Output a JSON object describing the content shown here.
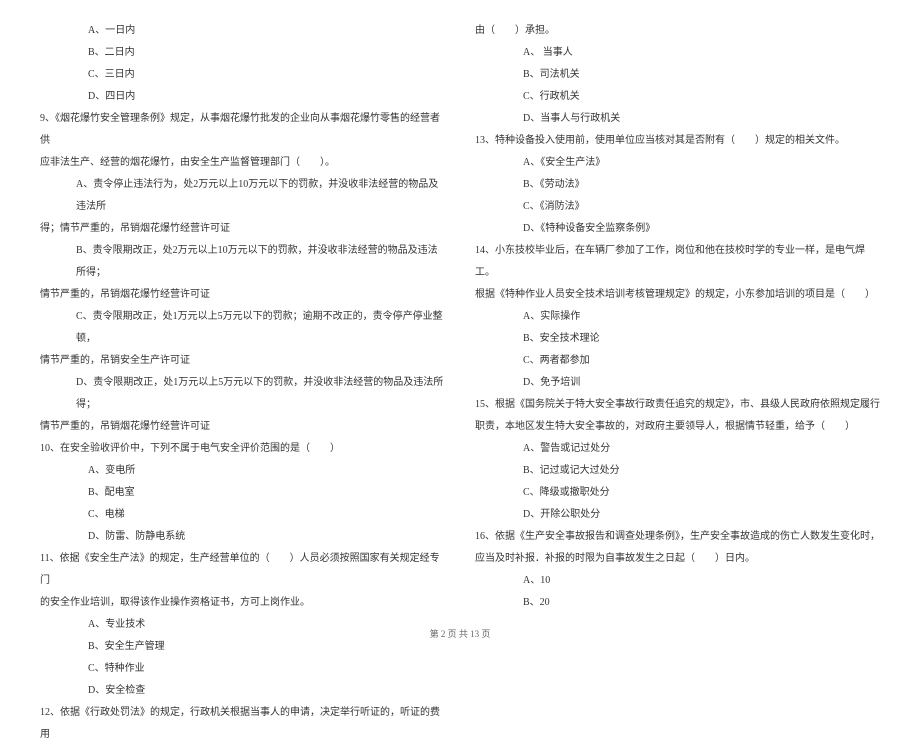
{
  "left_column": {
    "q8_options": [
      "A、一日内",
      "B、二日内",
      "C、三日内",
      "D、四日内"
    ],
    "q9_text": "9、《烟花爆竹安全管理条例》规定，从事烟花爆竹批发的企业向从事烟花爆竹零售的经营者供",
    "q9_continue": "应非法生产、经营的烟花爆竹，由安全生产监督管理部门（　　）。",
    "q9_options": [
      "A、责令停止违法行为，处2万元以上10万元以下的罚款，并没收非法经营的物品及违法所",
      "得；情节严重的，吊销烟花爆竹经营许可证",
      "B、责令限期改正，处2万元以上10万元以下的罚款，并没收非法经营的物品及违法所得；",
      "情节严重的，吊销烟花爆竹经营许可证",
      "C、责令限期改正，处1万元以上5万元以下的罚款；逾期不改正的，责令停产停业整顿，",
      "情节严重的，吊销安全生产许可证",
      "D、责令限期改正，处1万元以上5万元以下的罚款，并没收非法经营的物品及违法所得；",
      "情节严重的，吊销烟花爆竹经营许可证"
    ],
    "q10_text": "10、在安全验收评价中，下列不属于电气安全评价范围的是（　　）",
    "q10_options": [
      "A、变电所",
      "B、配电室",
      "C、电梯",
      "D、防雷、防静电系统"
    ],
    "q11_text": "11、依据《安全生产法》的规定，生产经营单位的（　　）人员必须按照国家有关规定经专门",
    "q11_continue": "的安全作业培训，取得该作业操作资格证书，方可上岗作业。",
    "q11_options": [
      "A、专业技术",
      "B、安全生产管理",
      "C、特种作业",
      "D、安全检查"
    ],
    "q12_text": "12、依据《行政处罚法》的规定，行政机关根据当事人的申请，决定举行听证的，听证的费用"
  },
  "right_column": {
    "q12_continue": "由（　　）承担。",
    "q12_options": [
      "A、 当事人",
      "B、司法机关",
      "C、行政机关",
      "D、当事人与行政机关"
    ],
    "q13_text": "13、特种设备投入使用前，使用单位应当核对其是否附有（　　）规定的相关文件。",
    "q13_options": [
      "A、《安全生产法》",
      "B、《劳动法》",
      "C、《消防法》",
      "D、《特种设备安全监察条例》"
    ],
    "q14_text": "14、小东技校毕业后，在车辆厂参加了工作，岗位和他在技校时学的专业一样，是电气焊工。",
    "q14_continue": "根据《特种作业人员安全技术培训考核管理规定》的规定，小东参加培训的项目是（　　）",
    "q14_options": [
      "A、实际操作",
      "B、安全技术理论",
      "C、两者都参加",
      "D、免予培训"
    ],
    "q15_text": "15、根据《国务院关于特大安全事故行政责任追究的规定》，市、县级人民政府依照规定履行",
    "q15_continue": "职责，本地区发生特大安全事故的，对政府主要领导人，根据情节轻重，给予（　　）",
    "q15_options": [
      "A、警告或记过处分",
      "B、记过或记大过处分",
      "C、降级或撤职处分",
      "D、开除公职处分"
    ],
    "q16_text": "16、依据《生产安全事故报告和调查处理条例》，生产安全事故造成的伤亡人数发生变化时，",
    "q16_continue": "应当及时补报．补报的时限为自事故发生之日起（　　）日内。",
    "q16_options": [
      "A、10",
      "B、20"
    ]
  },
  "footer": {
    "page_text": "第 2 页 共 13 页"
  }
}
